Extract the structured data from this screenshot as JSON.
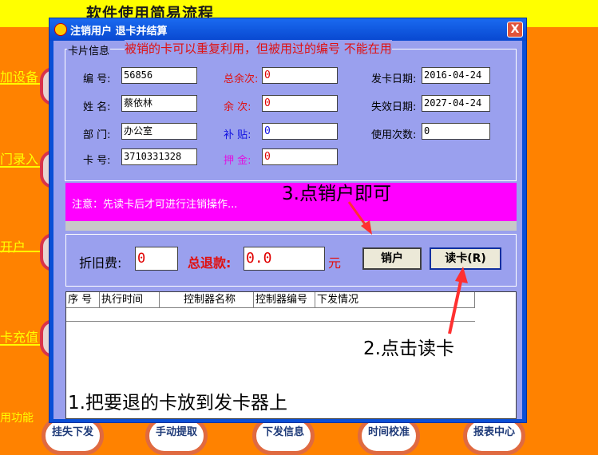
{
  "app": {
    "title": "软件使用简易流程"
  },
  "sidebar": {
    "items": [
      "加设备",
      "门录入",
      "开户",
      "卡充值",
      "用功能"
    ]
  },
  "bottom_buttons": [
    "挂失下发",
    "手动提取",
    "下发信息",
    "时间校准",
    "报表中心"
  ],
  "dialog": {
    "title": "注销用户  退卡并结算",
    "close": "X",
    "card_group_label": "卡片信息",
    "card_note": "被销的卡可以重复利用，但被用过的编号 不能在用",
    "fields": {
      "number_label": "编  号:",
      "number": "56856",
      "name_label": "姓  名:",
      "name": "蔡依林",
      "dept_label": "部  门:",
      "dept": "办公室",
      "card_label": "卡  号:",
      "card": "3710331328",
      "total_balance_label": "总余次:",
      "total_balance": "0",
      "balance_label": "余  次:",
      "balance": "0",
      "subsidy_label": "补  贴:",
      "subsidy": "0",
      "deposit_label": "押  金:",
      "deposit": "0",
      "issue_date_label": "发卡日期:",
      "issue_date": "2016-04-24",
      "expire_date_label": "失效日期:",
      "expire_date": "2027-04-24",
      "use_count_label": "使用次数:",
      "use_count": "0"
    },
    "warning": "注意：先读卡后才可进行注销操作...",
    "settlement": {
      "depreciation_label": "折旧费:",
      "depreciation": "0",
      "refund_label": "总退款:",
      "refund": "0.0",
      "unit": "元",
      "cancel_button": "销户",
      "read_button": "读卡(R)"
    },
    "table": {
      "columns": [
        "序 号",
        "执行时间",
        "控制器名称",
        "控制器编号",
        "下发情况"
      ]
    }
  },
  "annotations": {
    "step1": "1.把要退的卡放到发卡器上",
    "step2": "2.点击读卡",
    "step3": "3.点销户即可"
  },
  "colors": {
    "background": "#ff8200",
    "topbar": "#ffff00",
    "dialog_bg": "#9aa0ee",
    "magenta": "#ff00ff",
    "arrow": "#ff3030"
  }
}
